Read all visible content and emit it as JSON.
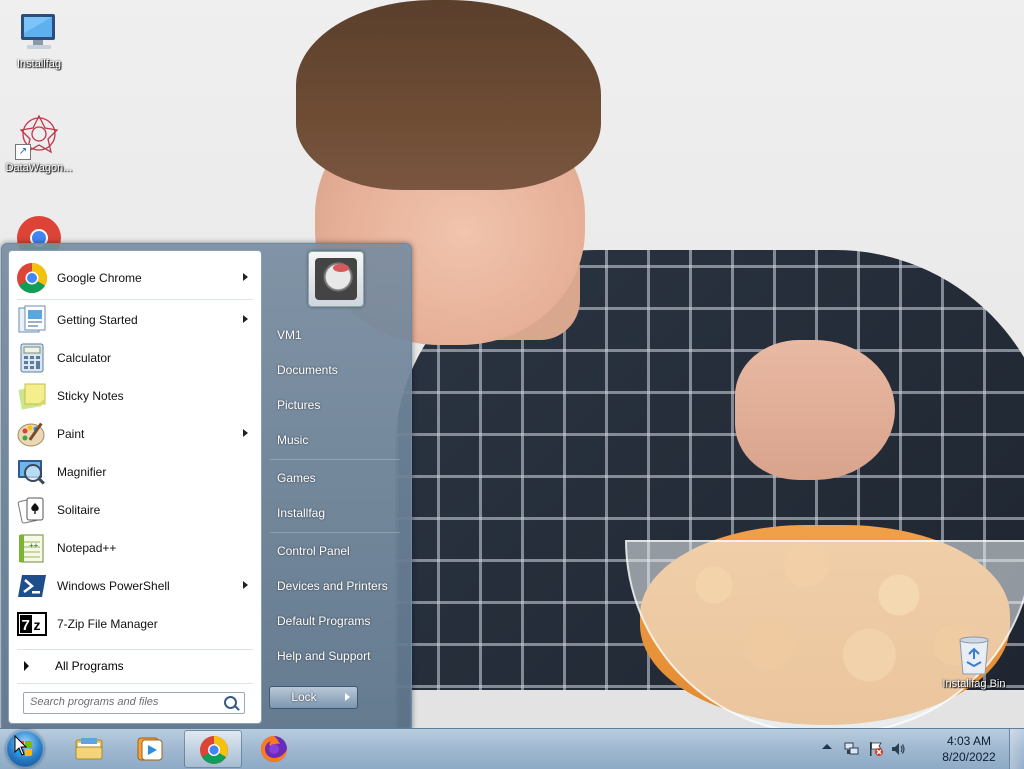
{
  "desktop": {
    "icons": [
      {
        "label": "Installfag",
        "icon": "computer-icon"
      },
      {
        "label": "DataWagon...",
        "icon": "datawagon-icon"
      },
      {
        "label": "",
        "icon": "chrome-icon"
      },
      {
        "label": "Installfag Bin",
        "icon": "recycle-bin-icon"
      }
    ]
  },
  "start_menu": {
    "programs": [
      {
        "label": "Google Chrome",
        "icon": "chrome-icon",
        "has_submenu": true
      },
      {
        "label": "Getting Started",
        "icon": "getting-started-icon",
        "has_submenu": true
      },
      {
        "label": "Calculator",
        "icon": "calculator-icon",
        "has_submenu": false
      },
      {
        "label": "Sticky Notes",
        "icon": "sticky-notes-icon",
        "has_submenu": false
      },
      {
        "label": "Paint",
        "icon": "paint-icon",
        "has_submenu": true
      },
      {
        "label": "Magnifier",
        "icon": "magnifier-icon",
        "has_submenu": false
      },
      {
        "label": "Solitaire",
        "icon": "solitaire-icon",
        "has_submenu": false
      },
      {
        "label": "Notepad++",
        "icon": "notepadpp-icon",
        "has_submenu": false
      },
      {
        "label": "Windows PowerShell",
        "icon": "powershell-icon",
        "has_submenu": true
      },
      {
        "label": "7-Zip File Manager",
        "icon": "7zip-icon",
        "has_submenu": false
      }
    ],
    "all_programs_label": "All Programs",
    "search_placeholder": "Search programs and files",
    "right_links": [
      "VM1",
      "Documents",
      "Pictures",
      "Music",
      "Games",
      "Installfag",
      "Control Panel",
      "Devices and Printers",
      "Default Programs",
      "Help and Support"
    ],
    "lock_label": "Lock"
  },
  "taskbar": {
    "pinned": [
      {
        "name": "explorer",
        "icon": "folder-icon",
        "active": false
      },
      {
        "name": "media-player",
        "icon": "media-player-icon",
        "active": false
      },
      {
        "name": "chrome",
        "icon": "chrome-icon",
        "active": true
      },
      {
        "name": "firefox",
        "icon": "firefox-icon",
        "active": false
      }
    ],
    "tray_icons": [
      "network-icon",
      "action-center-flag-icon",
      "volume-icon"
    ],
    "clock": {
      "time": "4:03 AM",
      "date": "8/20/2022"
    }
  },
  "colors": {
    "taskbar": "#9fb8d0",
    "start_menu_right": "#6f88a2",
    "chrome_red": "#db4437",
    "chrome_yellow": "#f4c20d",
    "chrome_green": "#0f9d58",
    "chrome_blue": "#4285f4"
  }
}
